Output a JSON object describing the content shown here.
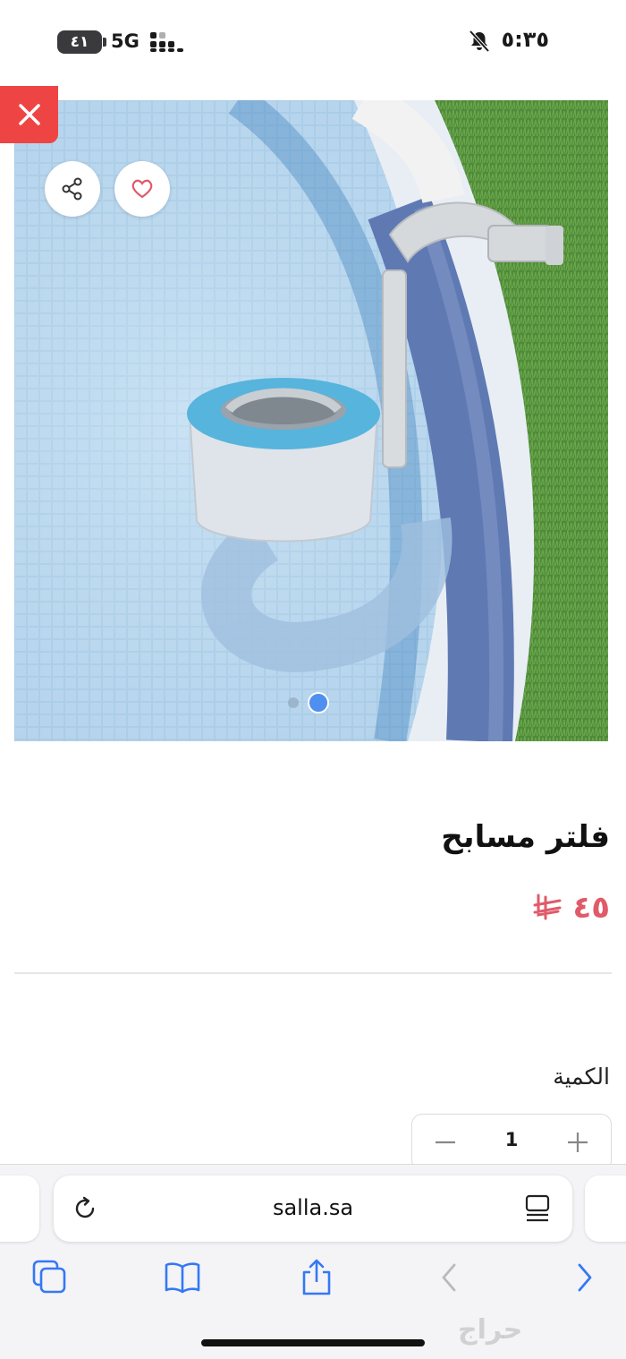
{
  "status_bar": {
    "time": "٥:٣٥",
    "battery": "٤١",
    "network": "5G",
    "icons": [
      "bell-off-icon",
      "signal-icon",
      "battery-icon"
    ]
  },
  "product": {
    "title": "فلتر مسابح",
    "price": "٤٥",
    "currency_icon": "riyal-icon",
    "image_count": 2,
    "active_image": 2
  },
  "quantity": {
    "label": "الكمية",
    "value": "1"
  },
  "browser": {
    "url": "salla.sa",
    "toolbar_icons": [
      "tabs-icon",
      "bookmarks-icon",
      "share-icon",
      "back-icon",
      "forward-icon"
    ]
  },
  "watermark": "حراج",
  "colors": {
    "accent": "#ef4444",
    "price": "#e05a6a",
    "link": "#3478f6",
    "active_dot": "#4f8ff0"
  }
}
